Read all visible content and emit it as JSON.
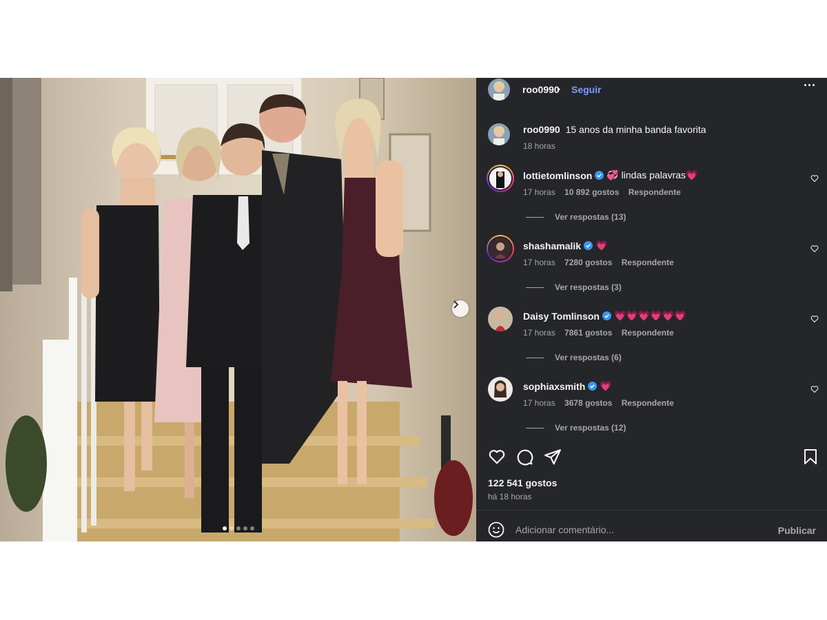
{
  "post": {
    "author": {
      "username": "roo0990",
      "separator": "•",
      "follow_label": "Seguir"
    },
    "caption": {
      "username": "roo0990",
      "text": "15 anos da minha banda favorita",
      "time": "18 horas"
    },
    "comments": [
      {
        "username": "lottietomlinson",
        "verified": true,
        "text": "💞 lindas palavras💗",
        "time": "17 horas",
        "likes": "10 892 gostos",
        "reply_label": "Respondente",
        "replies_label": "Ver respostas (13)"
      },
      {
        "username": "shashamalik",
        "verified": true,
        "text": "💗",
        "time": "17 horas",
        "likes": "7280 gostos",
        "reply_label": "Respondente",
        "replies_label": "Ver respostas (3)"
      },
      {
        "username": "Daisy Tomlinson",
        "verified": true,
        "text": "💗💗💗💗💗💗",
        "time": "17 horas",
        "likes": "7861 gostos",
        "reply_label": "Respondente",
        "replies_label": "Ver respostas (6)"
      },
      {
        "username": "sophiaxsmith",
        "verified": true,
        "text": "💗",
        "time": "17 horas",
        "likes": "3678 gostos",
        "reply_label": "Respondente",
        "replies_label": "Ver respostas (12)"
      }
    ],
    "likes_total": "122 541 gostos",
    "posted_ago": "há 18 horas",
    "comment_placeholder": "Adicionar comentário...",
    "publish_label": "Publicar",
    "carousel": {
      "total_slides": 5,
      "active_slide": 1
    }
  },
  "colors": {
    "panel_bg": "#25262a",
    "link_blue": "#7e9cff",
    "verified_blue": "#3897f0",
    "muted_text": "#a8a8a8"
  },
  "icons": [
    "more-options-icon",
    "verified-badge-icon",
    "heart-icon",
    "comment-icon",
    "share-icon",
    "bookmark-icon",
    "emoji-icon",
    "chevron-right-icon"
  ]
}
